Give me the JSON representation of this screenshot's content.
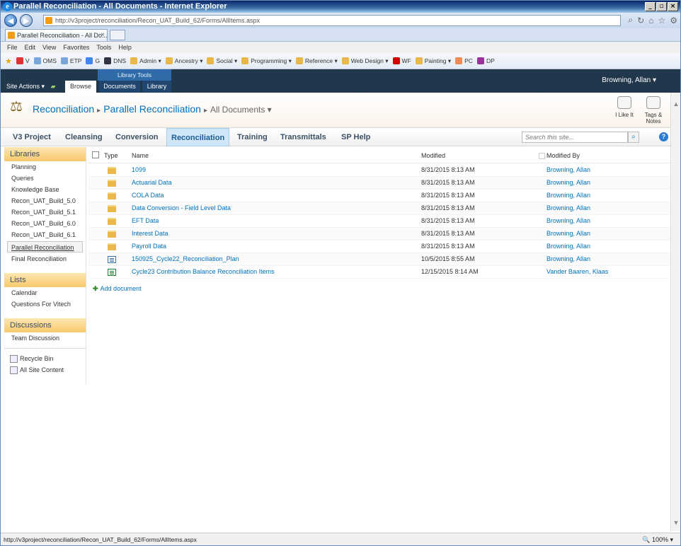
{
  "window": {
    "title": "Parallel Reconciliation - All Documents - Internet Explorer"
  },
  "browser": {
    "address": "http://v3project/reconciliation/Recon_UAT_Build_62/Forms/AllItems.aspx",
    "tab_title": "Parallel Reconciliation - All Do...",
    "menu": [
      "File",
      "Edit",
      "View",
      "Favorites",
      "Tools",
      "Help"
    ],
    "favorites": [
      {
        "label": "V",
        "icon": "v-icon"
      },
      {
        "label": "OMS",
        "icon": "page-icon"
      },
      {
        "label": "ETP",
        "icon": "page-icon"
      },
      {
        "label": "G",
        "icon": "google-icon"
      },
      {
        "label": "DNS",
        "icon": "dns-icon"
      },
      {
        "label": "Admin ▾",
        "icon": "folder-icon"
      },
      {
        "label": "Ancestry ▾",
        "icon": "folder-icon"
      },
      {
        "label": "Social ▾",
        "icon": "folder-icon"
      },
      {
        "label": "Programming ▾",
        "icon": "folder-icon"
      },
      {
        "label": "Reference ▾",
        "icon": "folder-icon"
      },
      {
        "label": "Web Design ▾",
        "icon": "folder-icon"
      },
      {
        "label": "WF",
        "icon": "wf-icon"
      },
      {
        "label": "Painting ▾",
        "icon": "folder-icon"
      },
      {
        "label": "PC",
        "icon": "pc-icon"
      },
      {
        "label": "DP",
        "icon": "dp-icon"
      }
    ],
    "status_url": "http://v3project/reconciliation/Recon_UAT_Build_62/Forms/AllItems.aspx",
    "zoom": "100%"
  },
  "ribbon": {
    "site_actions": "Site Actions ▾",
    "library_tools": "Library Tools",
    "tabs": {
      "browse": "Browse",
      "documents": "Documents",
      "library": "Library"
    },
    "user": "Browning, Allan ▾"
  },
  "titlearea": {
    "breadcrumb": [
      "Reconciliation",
      "Parallel Reconciliation",
      "All Documents ▾"
    ],
    "like": "I Like It",
    "tags": "Tags &\nNotes"
  },
  "topnav": {
    "items": [
      "V3 Project",
      "Cleansing",
      "Conversion",
      "Reconciliation",
      "Training",
      "Transmittals",
      "SP Help"
    ],
    "search_placeholder": "Search this site..."
  },
  "leftnav": {
    "libraries_head": "Libraries",
    "libraries": [
      "Planning",
      "Queries",
      "Knowledge Base",
      "Recon_UAT_Build_5.0",
      "Recon_UAT_Build_5.1",
      "Recon_UAT_Build_6.0",
      "Recon_UAT_Build_6.1",
      "Parallel Reconciliation",
      "Final Reconciliation"
    ],
    "lists_head": "Lists",
    "lists": [
      "Calendar",
      "Questions For Vitech"
    ],
    "discussions_head": "Discussions",
    "discussions": [
      "Team Discussion"
    ],
    "recycle": "Recycle Bin",
    "all_content": "All Site Content"
  },
  "list": {
    "columns": {
      "type": "Type",
      "name": "Name",
      "modified": "Modified",
      "modified_by": "Modified By"
    },
    "rows": [
      {
        "type": "folder",
        "name": "1099",
        "modified": "8/31/2015 8:13 AM",
        "by": "Browning, Allan"
      },
      {
        "type": "folder",
        "name": "Actuarial Data",
        "modified": "8/31/2015 8:13 AM",
        "by": "Browning, Allan"
      },
      {
        "type": "folder",
        "name": "COLA Data",
        "modified": "8/31/2015 8:13 AM",
        "by": "Browning, Allan"
      },
      {
        "type": "folder",
        "name": "Data Conversion - Field Level Data",
        "modified": "8/31/2015 8:13 AM",
        "by": "Browning, Allan"
      },
      {
        "type": "folder",
        "name": "EFT Data",
        "modified": "8/31/2015 8:13 AM",
        "by": "Browning, Allan"
      },
      {
        "type": "folder",
        "name": "Interest Data",
        "modified": "8/31/2015 8:13 AM",
        "by": "Browning, Allan"
      },
      {
        "type": "folder",
        "name": "Payroll Data",
        "modified": "8/31/2015 8:13 AM",
        "by": "Browning, Allan"
      },
      {
        "type": "doc",
        "name": "150925_Cycle22_Reconciliation_Plan",
        "modified": "10/5/2015 8:55 AM",
        "by": "Browning, Allan"
      },
      {
        "type": "xls",
        "name": "Cycle23 Contribution Balance Reconciliation Items",
        "modified": "12/15/2015 8:14 AM",
        "by": "Vander Baaren, Klaas"
      }
    ],
    "add_document": "Add document"
  }
}
